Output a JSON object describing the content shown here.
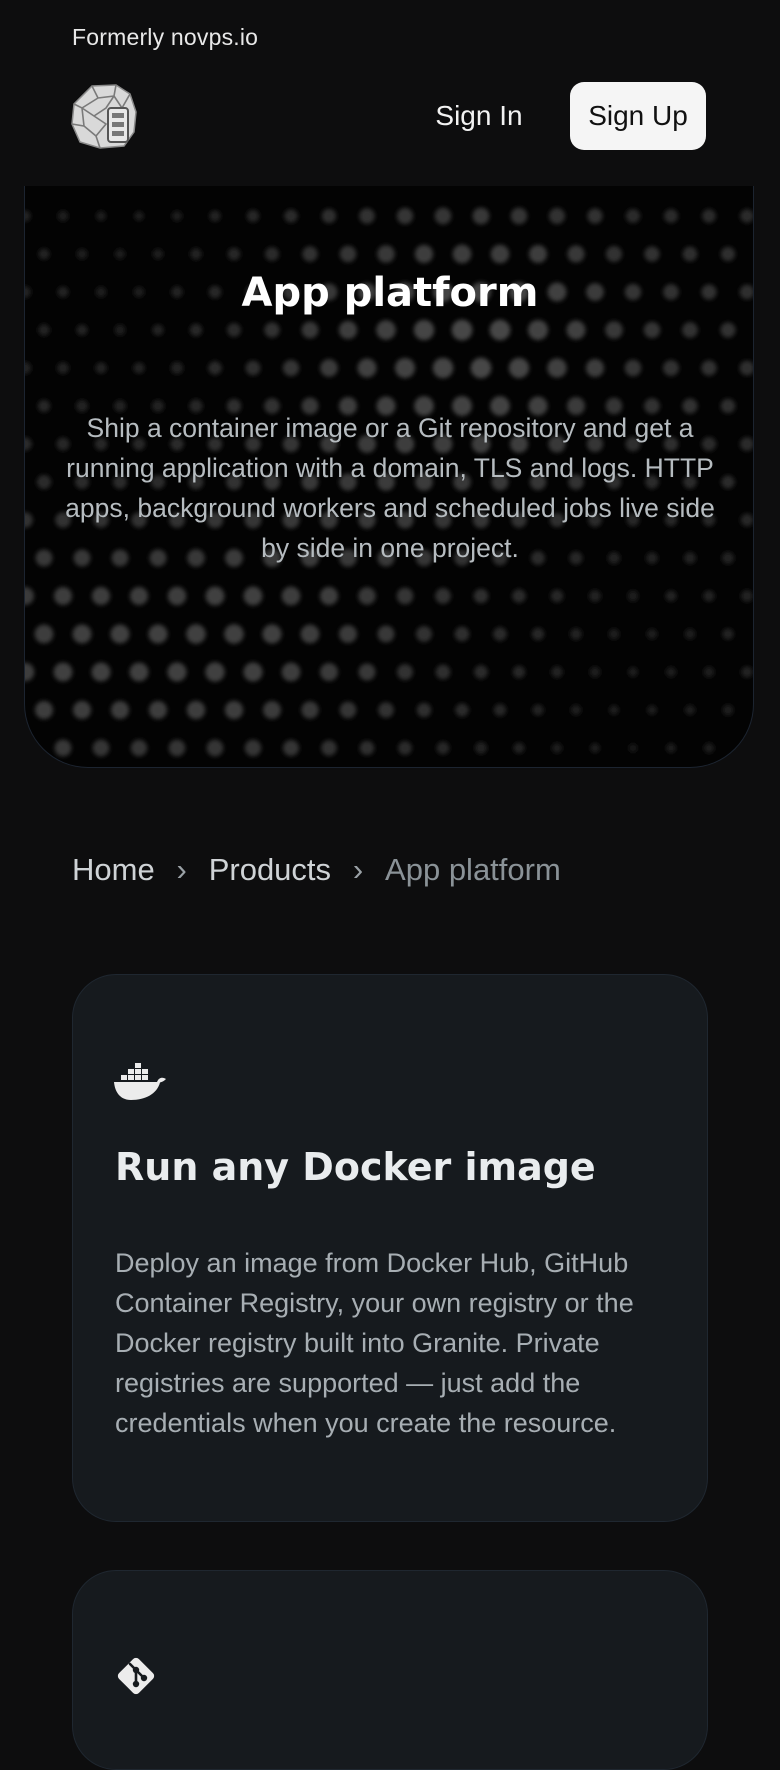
{
  "header": {
    "formerly_text": "Formerly novps.io",
    "logo_icon": "granite-rock-logo-icon",
    "sign_in_label": "Sign In",
    "sign_up_label": "Sign Up"
  },
  "hero": {
    "title": "App platform",
    "description": "Ship a container image or a Git repository and get a running application with a domain, TLS and logs. HTTP apps, background workers and scheduled jobs live side by side in one project."
  },
  "breadcrumb": {
    "items": [
      "Home",
      "Products",
      "App platform"
    ],
    "separator": "›"
  },
  "features": [
    {
      "icon": "docker-whale-icon",
      "title": "Run any Docker image",
      "description": "Deploy an image from Docker Hub, GitHub Container Registry, your own registry or the Docker registry built into Granite. Private registries are supported — just add the credentials when you create the resource."
    },
    {
      "icon": "git-icon"
    }
  ],
  "colors": {
    "page_background": "#0d0d0e",
    "hero_background": "#030303",
    "card_background": "#161a1e",
    "sign_up_background": "#f5f5f5",
    "muted_text": "#a7aeb3"
  }
}
